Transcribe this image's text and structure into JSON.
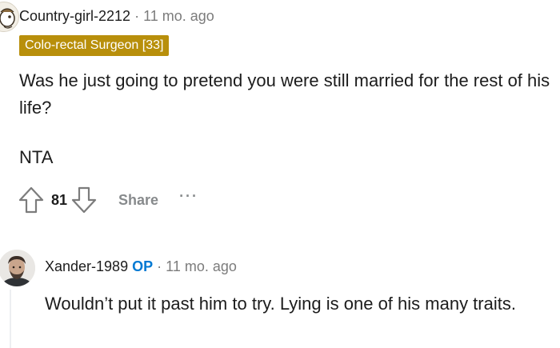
{
  "comment1": {
    "username": "Country-girl-2212",
    "separator": "·",
    "time": "11 mo. ago",
    "flair": "Colo-rectal Surgeon [33]",
    "paragraphs": [
      "Was he just going to pretend you were still married for the rest of his life?",
      "NTA"
    ],
    "score": "81",
    "share_label": "Share",
    "more_label": "···",
    "icons": {
      "avatar": "snoo-avatar-icon",
      "upvote": "upvote-arrow-icon",
      "downvote": "downvote-arrow-icon"
    }
  },
  "comment2": {
    "username": "Xander-1989",
    "op_badge": "OP",
    "separator": "·",
    "time": "11 mo. ago",
    "text": "Wouldn’t put it past him to try. Lying is one of his many traits.",
    "icons": {
      "avatar": "user-avatar-icon"
    }
  },
  "colors": {
    "flair_bg": "#b88f0b",
    "op": "#0079d3",
    "muted": "#7c7c7c",
    "text": "#1c1c1c"
  }
}
